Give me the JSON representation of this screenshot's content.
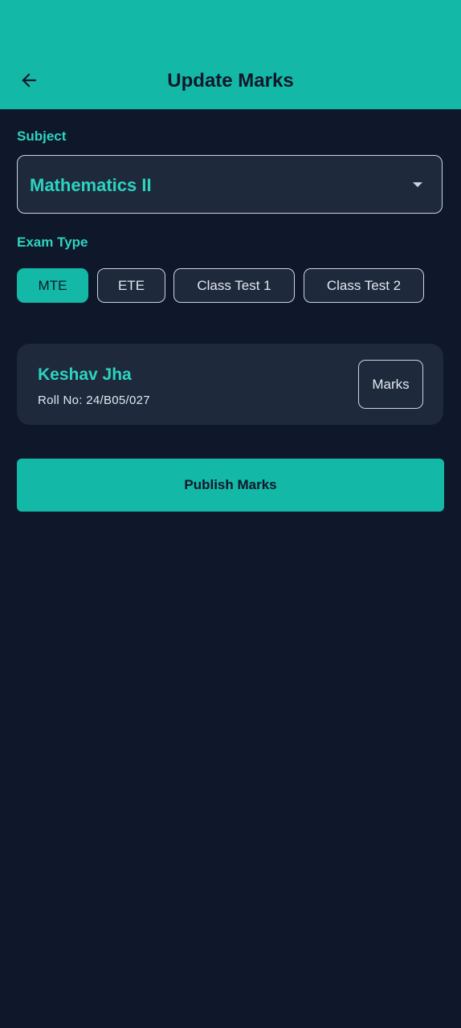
{
  "header": {
    "title": "Update Marks",
    "back_icon": "arrow-left-icon"
  },
  "subject": {
    "label": "Subject",
    "selected": "Mathematics II",
    "caret_icon": "caret-down-icon"
  },
  "exam_type": {
    "label": "Exam Type",
    "options": [
      "MTE",
      "ETE",
      "Class Test 1",
      "Class Test 2"
    ],
    "selected": "MTE"
  },
  "students": [
    {
      "name": "Keshav Jha",
      "roll": "Roll No: 24/B05/027",
      "marks_label": "Marks"
    }
  ],
  "actions": {
    "publish_label": "Publish Marks"
  },
  "colors": {
    "accent": "#14b8a6",
    "accent_text": "#2dd4bf",
    "background": "#0f172a",
    "card": "#1e293b"
  }
}
